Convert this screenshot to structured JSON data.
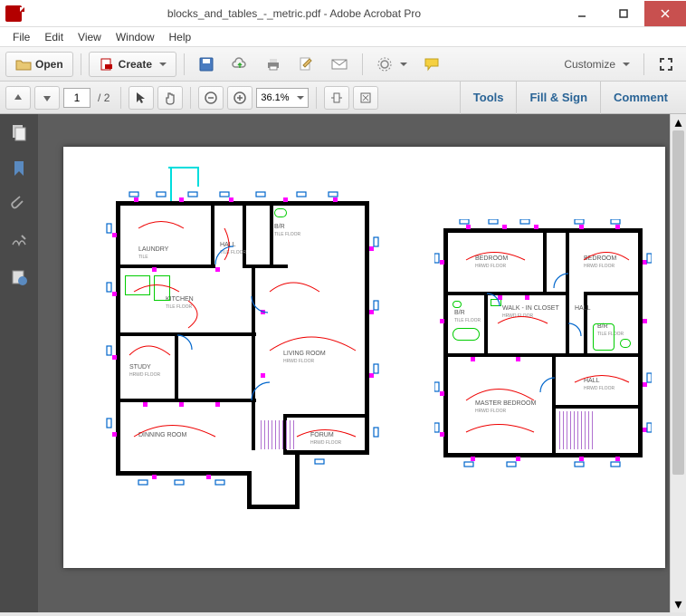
{
  "window": {
    "title": "blocks_and_tables_-_metric.pdf - Adobe Acrobat Pro"
  },
  "menu": {
    "file": "File",
    "edit": "Edit",
    "view": "View",
    "window": "Window",
    "help": "Help"
  },
  "toolbar1": {
    "open": "Open",
    "create": "Create",
    "customize": "Customize"
  },
  "toolbar2": {
    "page_current": "1",
    "page_sep": "/",
    "page_total": "2",
    "zoom_value": "36.1%",
    "tools": "Tools",
    "fill_sign": "Fill & Sign",
    "comment": "Comment"
  },
  "rooms_left": {
    "laundry": "LAUNDRY",
    "laundry_sub": "TILE",
    "hall": "HALL",
    "hall_sub": "TILE FLOOR",
    "br": "B/R",
    "br_sub": "TILE FLOOR",
    "kitchen": "KITCHEN",
    "kitchen_sub": "TILE FLOOR",
    "study": "STUDY",
    "study_sub": "HRWD FLOOR",
    "dining": "DINNING ROOM",
    "living": "LIVING ROOM",
    "living_sub": "HRWD FLOOR",
    "forum": "FORUM",
    "forum_sub": "HRWD FLOOR"
  },
  "rooms_right": {
    "bedroom1": "BEDROOM",
    "bedroom1_sub": "HRWD FLOOR",
    "bedroom2": "BEDROOM",
    "bedroom2_sub": "HRWD FLOOR",
    "walkin": "WALK - IN CLOSET",
    "walkin_sub": "HRWD FLOOR",
    "hall": "HALL",
    "br1": "B/R",
    "br1_sub": "TILE FLOOR",
    "br2": "B/R",
    "br2_sub": "TILE FLOOR",
    "master": "MASTER BEDROOM",
    "master_sub": "HRWD FLOOR",
    "hall2": "HALL",
    "hall2_sub": "HRWD FLOOR"
  }
}
